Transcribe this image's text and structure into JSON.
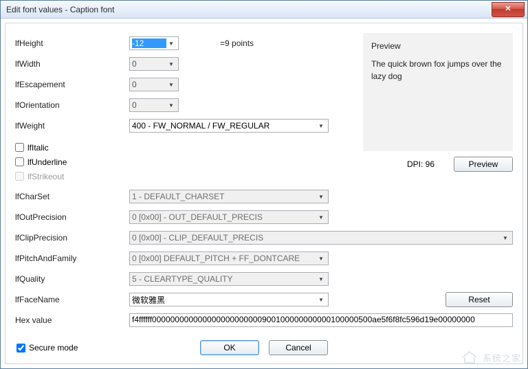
{
  "title": "Edit font values - Caption font",
  "labels": {
    "lfHeight": "lfHeight",
    "lfWidth": "lfWidth",
    "lfEscapement": "lfEscapement",
    "lfOrientation": "lfOrientation",
    "lfWeight": "lfWeight",
    "lfItalic": "lfItalic",
    "lfUnderline": "lfUnderline",
    "lfStrikeout": "lfStrikeout",
    "lfCharSet": "lfCharSet",
    "lfOutPrecision": "lfOutPrecision",
    "lfClipPrecision": "lfClipPrecision",
    "lfPitchAndFamily": "lfPitchAndFamily",
    "lfQuality": "lfQuality",
    "lfFaceName": "lfFaceName",
    "hexValue": "Hex value"
  },
  "values": {
    "lfHeight": "-12",
    "lfHeight_points": "=9 points",
    "lfWidth": "0",
    "lfEscapement": "0",
    "lfOrientation": "0",
    "lfWeight": "400 - FW_NORMAL / FW_REGULAR",
    "lfCharSet": "1 - DEFAULT_CHARSET",
    "lfOutPrecision": "0 [0x00] - OUT_DEFAULT_PRECIS",
    "lfClipPrecision": "0 [0x00] - CLIP_DEFAULT_PRECIS",
    "lfPitchAndFamily": "0 [0x00] DEFAULT_PITCH + FF_DONTCARE",
    "lfQuality": "5 - CLEARTYPE_QUALITY",
    "lfFaceName": "微软雅黑",
    "hex": "f4ffffff000000000000000000000000900100000000000100000500ae5f6f8fc596d19e00000000"
  },
  "checks": {
    "lfItalic": false,
    "lfUnderline": false,
    "lfStrikeout": false
  },
  "preview": {
    "title": "Preview",
    "sample": "The quick brown fox jumps over the lazy dog",
    "dpi_label": "DPI: 96"
  },
  "buttons": {
    "preview": "Preview",
    "reset": "Reset",
    "ok": "OK",
    "cancel": "Cancel",
    "secure": "Secure mode"
  },
  "watermark": "系统之家"
}
